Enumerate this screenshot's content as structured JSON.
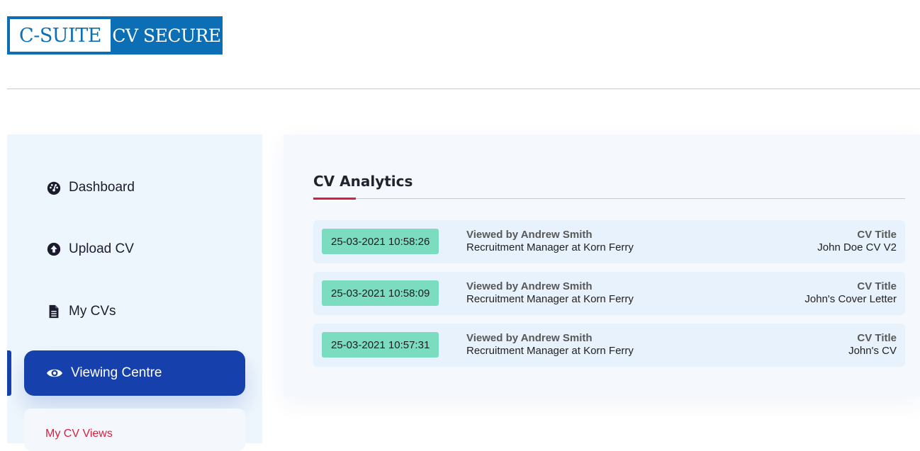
{
  "logo": {
    "left": "C-SUITE",
    "right": "CV SECURE"
  },
  "sidebar": {
    "items": [
      {
        "label": "Dashboard",
        "icon": "gauge-icon"
      },
      {
        "label": "Upload CV",
        "icon": "upload-circle-icon"
      },
      {
        "label": "My CVs",
        "icon": "document-icon"
      },
      {
        "label": "Viewing Centre",
        "icon": "eye-icon",
        "active": true
      }
    ],
    "subitems": [
      {
        "label": "My CV Views"
      }
    ]
  },
  "panel": {
    "title": "CV Analytics",
    "rows": [
      {
        "time": "25-03-2021 10:58:26",
        "viewer": "Viewed by Andrew Smith",
        "role": "Recruitment Manager at Korn Ferry",
        "cv_label": "CV Title",
        "cv_title": "John Doe CV V2"
      },
      {
        "time": "25-03-2021 10:58:09",
        "viewer": "Viewed by Andrew Smith",
        "role": "Recruitment Manager at Korn Ferry",
        "cv_label": "CV Title",
        "cv_title": "John's Cover Letter"
      },
      {
        "time": "25-03-2021 10:57:31",
        "viewer": "Viewed by Andrew Smith",
        "role": "Recruitment Manager at Korn Ferry",
        "cv_label": "CV Title",
        "cv_title": "John's CV"
      }
    ]
  },
  "colors": {
    "brand_blue": "#0c6fb5",
    "active_nav": "#1641ad",
    "accent_red": "#d6203f",
    "timestamp_badge": "#7bdcbf",
    "sidebar_bg": "#eef6fd"
  }
}
